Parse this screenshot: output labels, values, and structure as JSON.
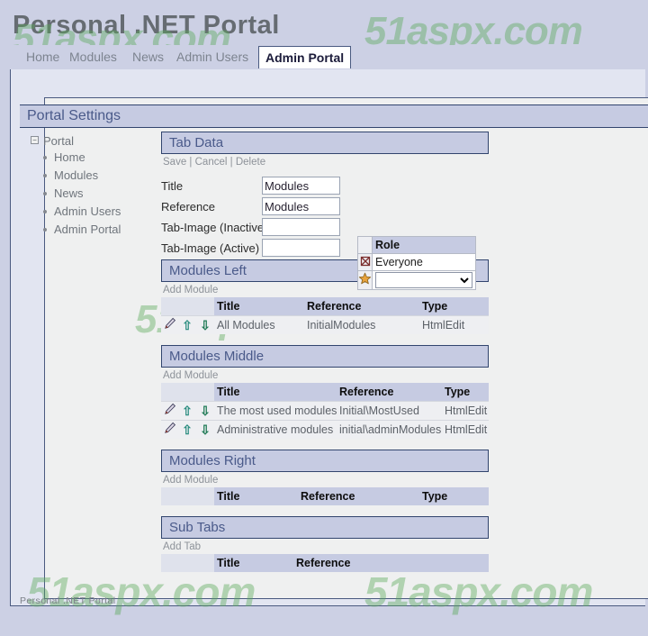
{
  "header": {
    "site_title": "Personal .NET Portal",
    "watermark": "51aspx.com"
  },
  "tabs": [
    {
      "label": "Home",
      "active": false
    },
    {
      "label": "Modules",
      "active": false
    },
    {
      "label": "News",
      "active": false
    },
    {
      "label": "Admin Users",
      "active": false
    },
    {
      "label": "Admin Portal",
      "active": true
    }
  ],
  "page": {
    "title": "Portal Settings"
  },
  "sidebar": {
    "root": {
      "label": "Portal",
      "toggle": "−"
    },
    "items": [
      {
        "label": "Home"
      },
      {
        "label": "Modules"
      },
      {
        "label": "News"
      },
      {
        "label": "Admin Users"
      },
      {
        "label": "Admin Portal"
      }
    ]
  },
  "tab_data": {
    "panel_title": "Tab Data",
    "actions": {
      "save": "Save",
      "cancel": "Cancel",
      "delete": "Delete",
      "separator": "|"
    },
    "fields": [
      {
        "label": "Title",
        "value": "Modules",
        "placeholder": ""
      },
      {
        "label": "Reference",
        "value": "Modules",
        "placeholder": ""
      },
      {
        "label": "Tab-Image (Inactive)",
        "value": "",
        "placeholder": ""
      },
      {
        "label": "Tab-Image (Active)",
        "value": "",
        "placeholder": ""
      }
    ],
    "role_table": {
      "header": "Role",
      "rows": [
        {
          "role": "Everyone",
          "icon": "delete-icon"
        }
      ],
      "add_row": {
        "icon": "add-star-icon",
        "selected_option": "",
        "options": [
          ""
        ]
      }
    }
  },
  "modules_left": {
    "panel_title": "Modules Left",
    "add_link": "Add Module",
    "columns": [
      "",
      "",
      "",
      "Title",
      "Reference",
      "Type"
    ],
    "rows": [
      {
        "title": "All Modules",
        "reference": "InitialModules",
        "type": "HtmlEdit"
      }
    ]
  },
  "modules_middle": {
    "panel_title": "Modules Middle",
    "add_link": "Add Module",
    "columns": [
      "",
      "",
      "",
      "Title",
      "Reference",
      "Type"
    ],
    "rows": [
      {
        "title": "The most used modules",
        "reference": "Initial\\MostUsed",
        "type": "HtmlEdit"
      },
      {
        "title": "Administrative modules",
        "reference": "initial\\adminModules",
        "type": "HtmlEdit"
      }
    ]
  },
  "modules_right": {
    "panel_title": "Modules Right",
    "add_link": "Add Module",
    "columns": [
      "",
      "",
      "",
      "Title",
      "Reference",
      "Type"
    ],
    "rows": []
  },
  "sub_tabs": {
    "panel_title": "Sub Tabs",
    "add_link": "Add Tab",
    "columns": [
      "",
      "",
      "",
      "Title",
      "Reference"
    ],
    "rows": []
  },
  "row_icons": {
    "edit": "pencil-icon",
    "move_up": "arrow-up-icon",
    "move_down": "arrow-down-icon"
  },
  "footer": {
    "text": "Personal .NET Portal"
  },
  "colors": {
    "page_background": "#ccd0e4",
    "panel_header": "#c6cbe2",
    "panel_border": "#32456e",
    "panel_title_text": "#4a5a8a",
    "content_background": "#eff0f0",
    "grid_header": "#c6cbe2",
    "grid_row": "#eeeff2",
    "watermark_green": "#5aa95a",
    "active_tab_background": "#ffffff"
  }
}
